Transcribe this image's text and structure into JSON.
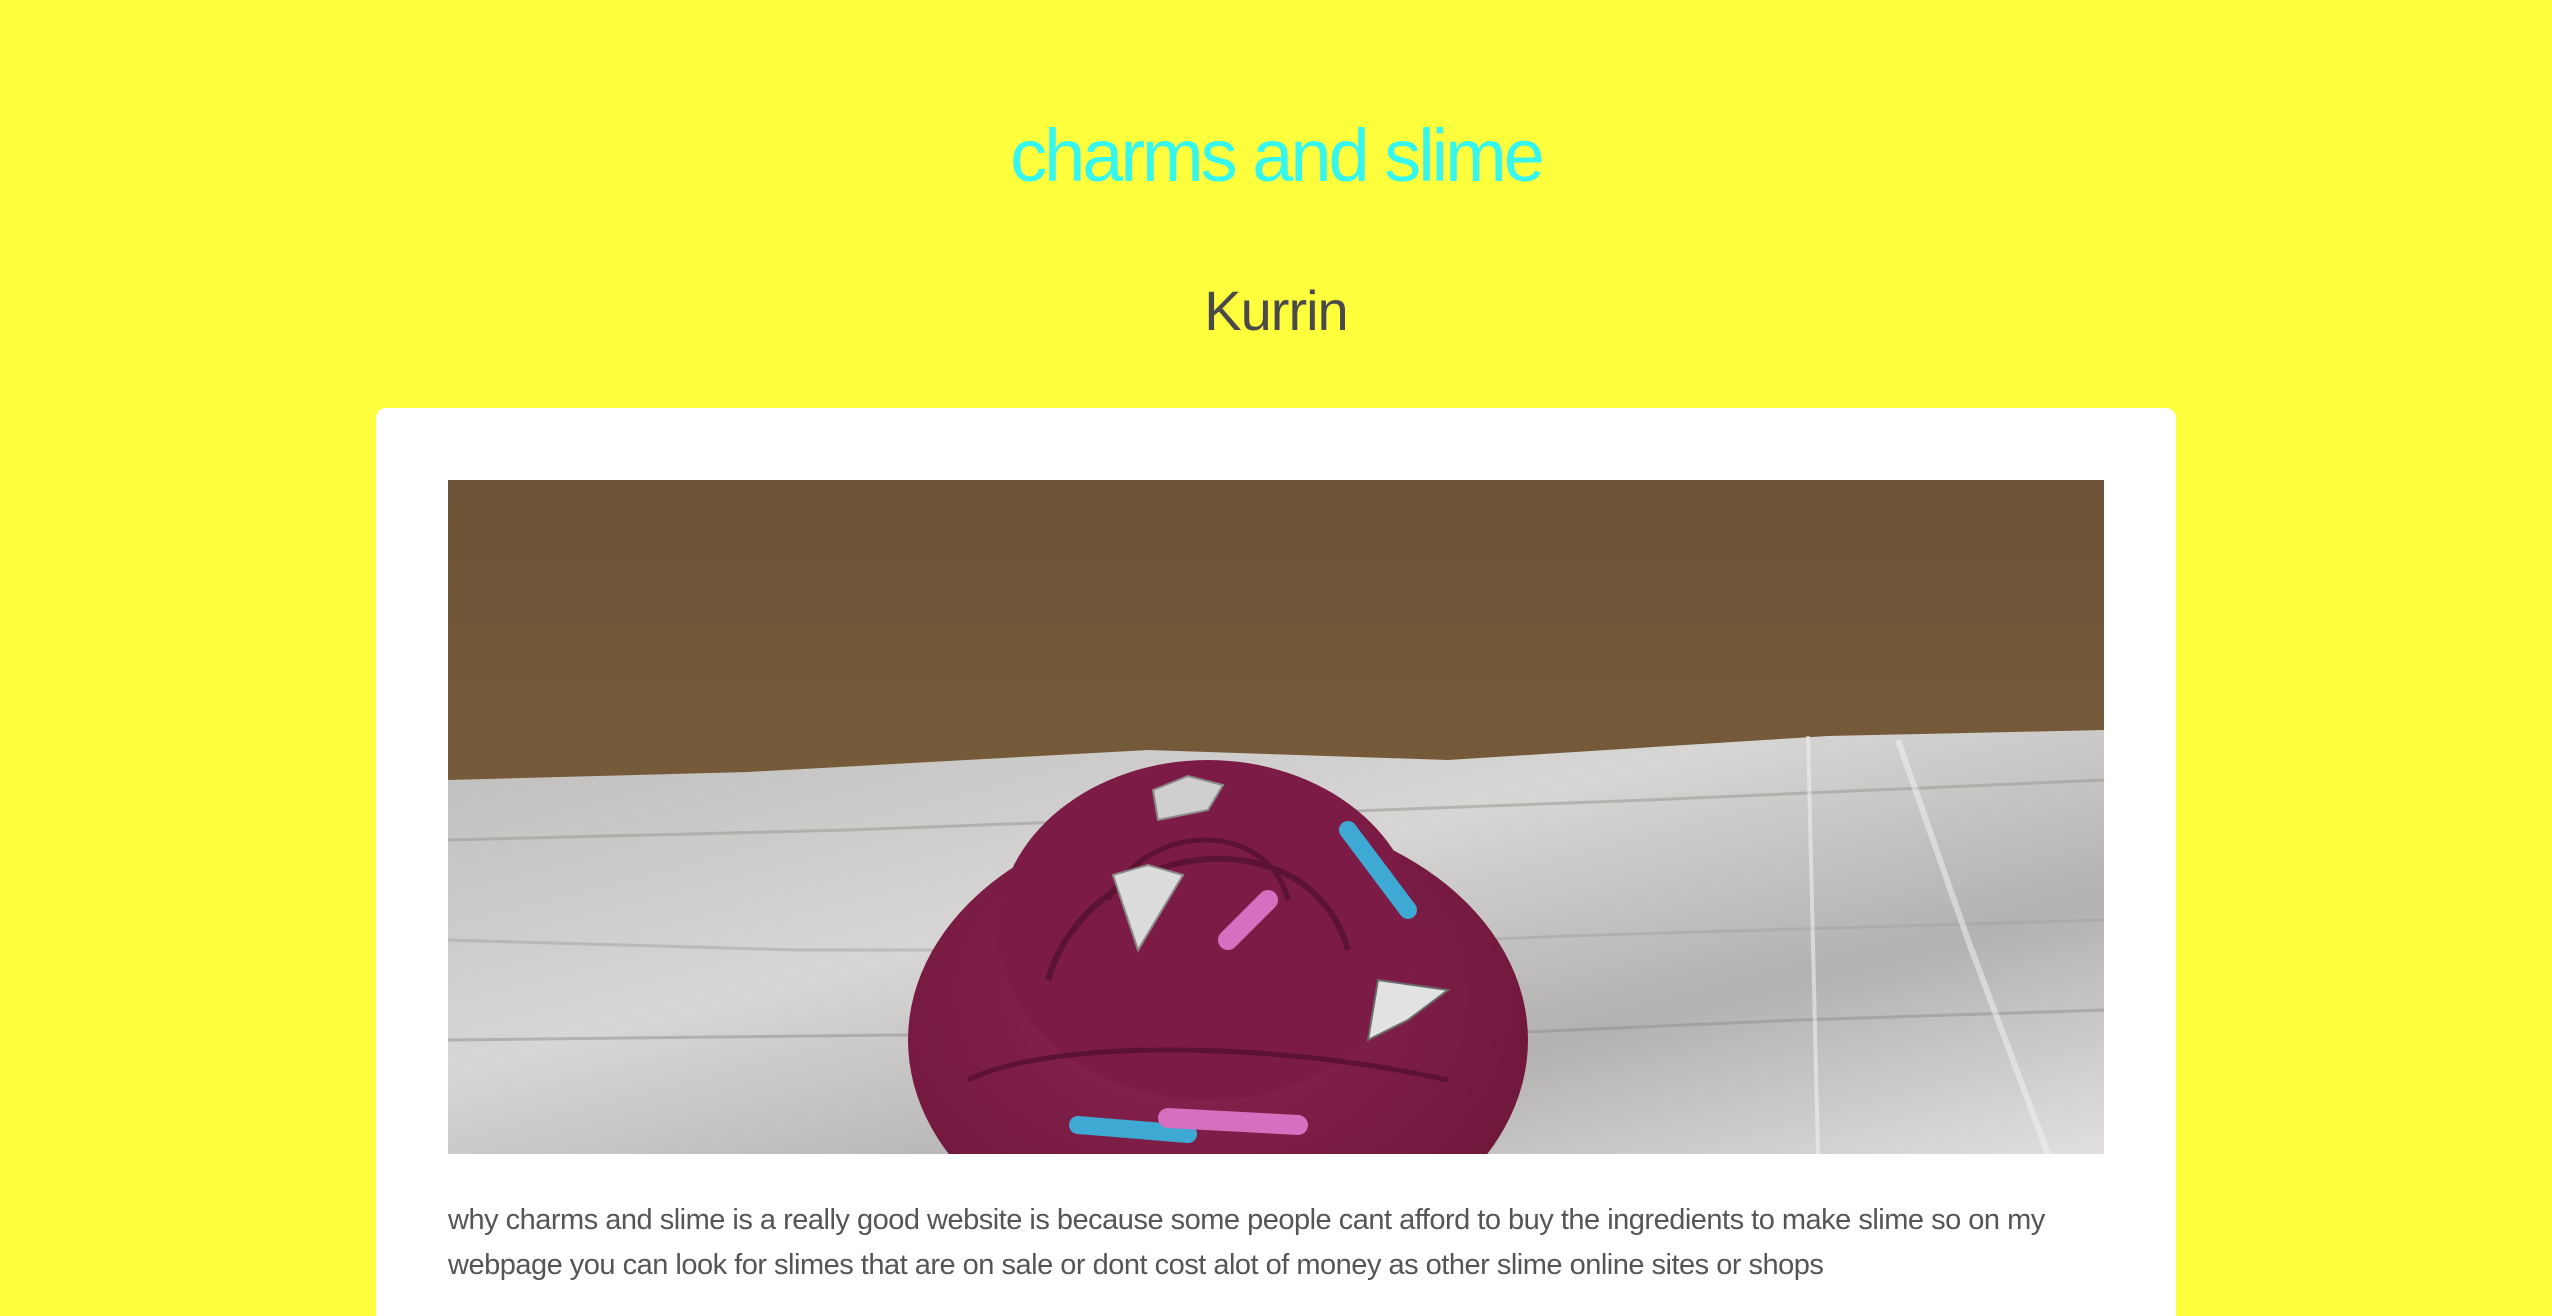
{
  "site": {
    "title": "charms and slime",
    "author": "Kurrin"
  },
  "post": {
    "image_alt": "purple slime swirl with charms and pipe cleaners on aluminum foil",
    "description": "why charms and slime is a really good website is because some people cant afford to buy the ingredients to make slime so on my webpage you can look for slimes that are on sale or dont cost alot of money as other slime online sites or shops"
  },
  "colors": {
    "page_background": "#ffff3d",
    "title_color": "#36f7ef",
    "text_color": "#4a4a4a",
    "card_background": "#ffffff"
  }
}
